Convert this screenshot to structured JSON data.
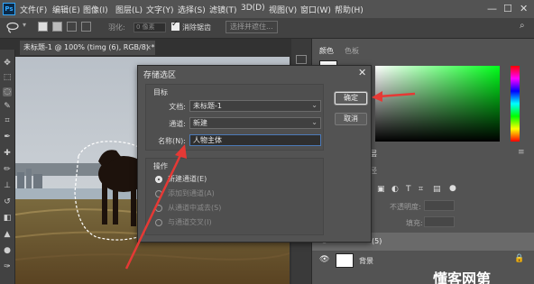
{
  "app": {
    "logo": "Ps"
  },
  "menu": [
    "文件(F)",
    "编辑(E)",
    "图像(I)",
    "图层(L)",
    "文字(Y)",
    "选择(S)",
    "滤镜(T)",
    "3D(D)",
    "视图(V)",
    "窗口(W)",
    "帮助(H)"
  ],
  "window_controls": [
    "—",
    "☐",
    "✕"
  ],
  "options_bar": {
    "feather_label": "羽化:",
    "feather_value": "0 像素",
    "antialias_label": "消除锯齿",
    "select_subject_label": "选择并遮住..."
  },
  "document": {
    "tab_title": "未标题-1 @ 100% (timg (6), RGB/8) *",
    "close_glyph": "×"
  },
  "panels": {
    "color_tab": "颜色",
    "swatches_tab": "色板",
    "layers_tab": "图层",
    "paths_tab": "路径",
    "opacity_label": "不透明度:",
    "fill_label": "填充:",
    "layer_partial_name": "(5)",
    "background_layer": "背景"
  },
  "dialog": {
    "title": "存储选区",
    "close_glyph": "✕",
    "target_group": "目标",
    "document_label": "文档:",
    "document_value": "未标题-1",
    "channel_label": "通道:",
    "channel_value": "新建",
    "name_label": "名称(N):",
    "name_value": "人物主体",
    "operation_group": "操作",
    "options": [
      {
        "label": "新建通道(E)",
        "selected": true,
        "enabled": true
      },
      {
        "label": "添加到通道(A)",
        "selected": false,
        "enabled": false
      },
      {
        "label": "从通道中减去(S)",
        "selected": false,
        "enabled": false
      },
      {
        "label": "与通道交叉(I)",
        "selected": false,
        "enabled": false
      }
    ],
    "ok": "确定",
    "cancel": "取消"
  },
  "watermark": "懂客网第",
  "colors": {
    "accent_arrow": "#e53935",
    "ps_blue": "#31a8ff"
  }
}
